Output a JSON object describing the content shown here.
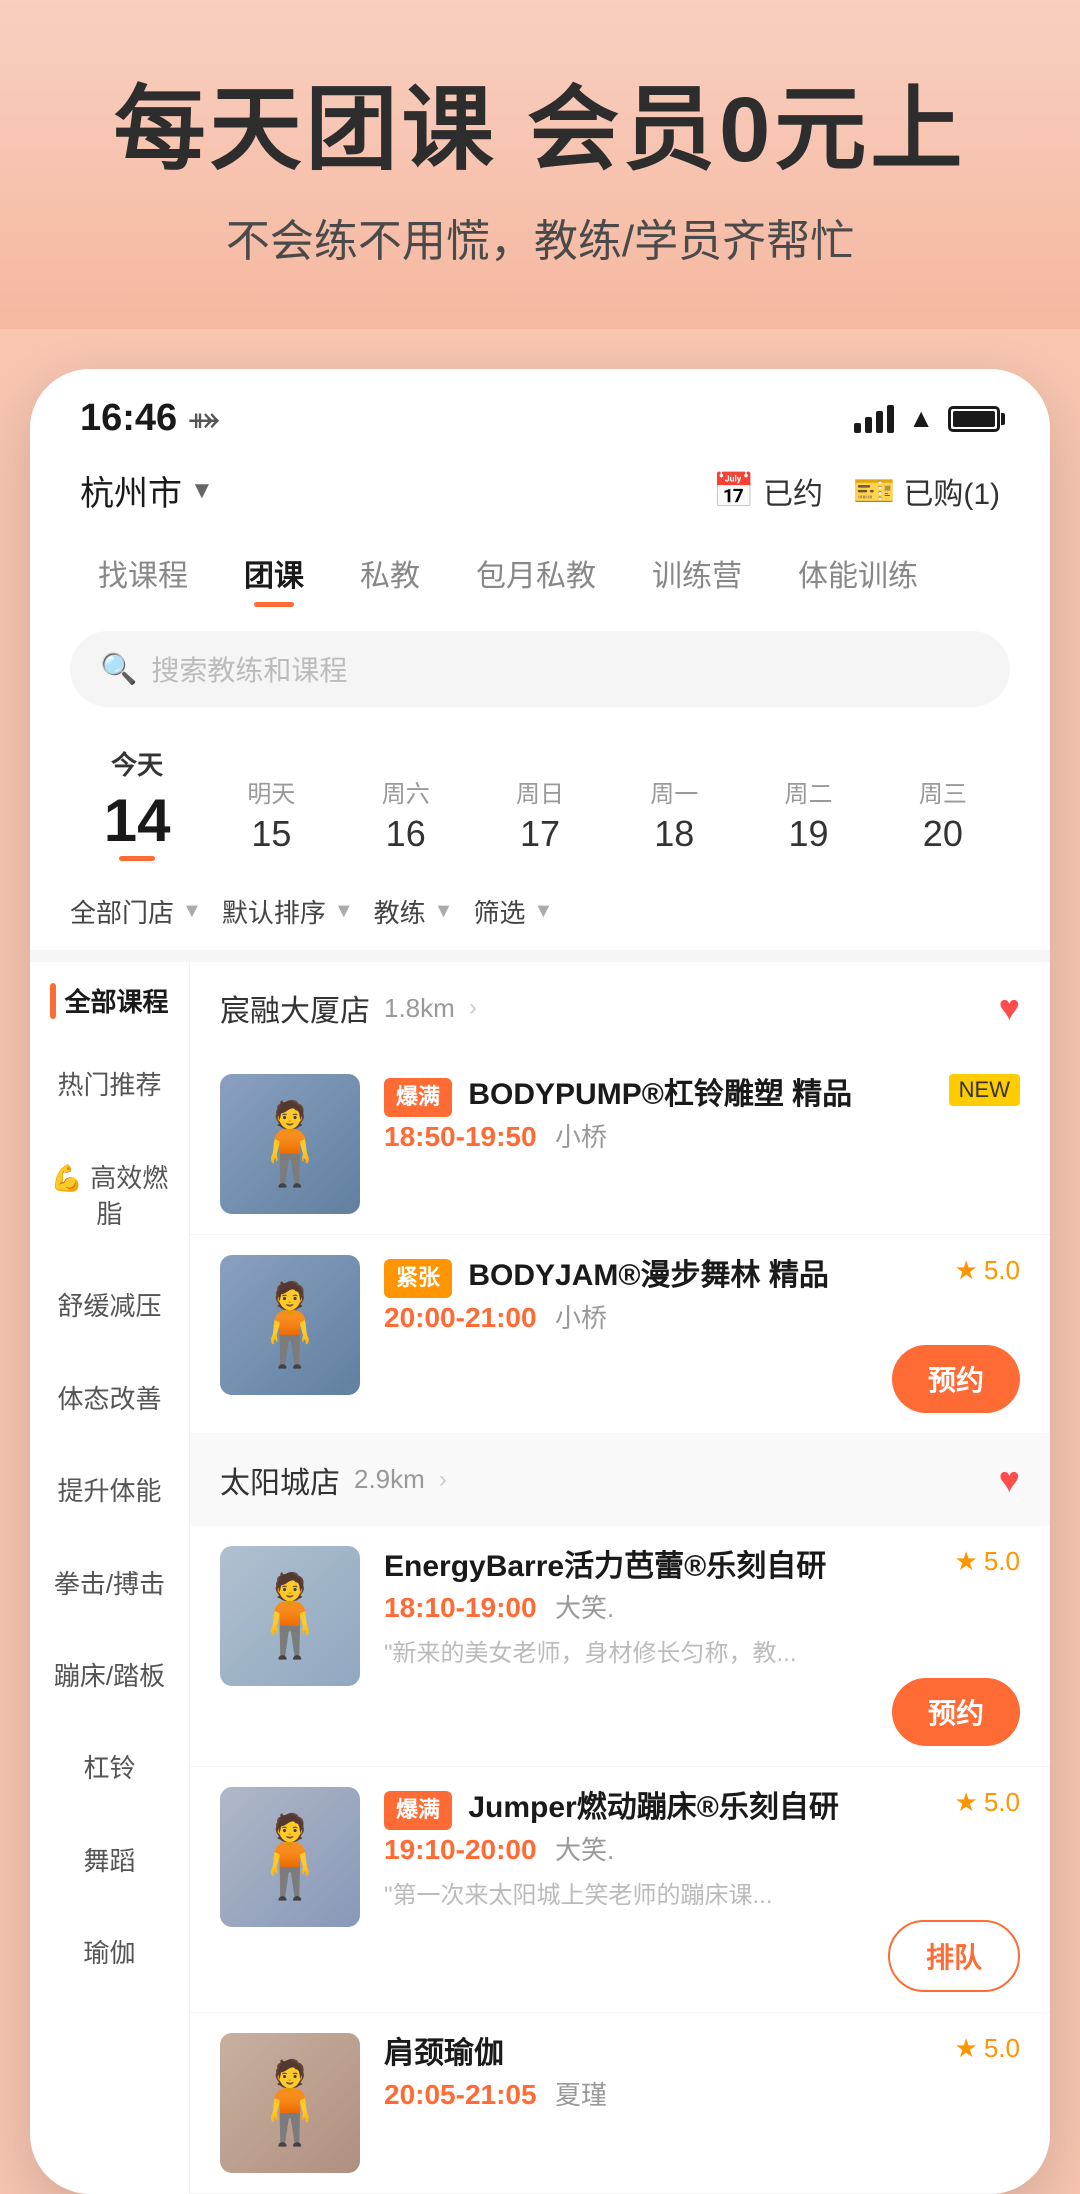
{
  "hero": {
    "title": "每天团课 会员0元上",
    "subtitle": "不会练不用慌，教练/学员齐帮忙"
  },
  "statusBar": {
    "time": "16:46",
    "navIcon": "⤀"
  },
  "header": {
    "location": "杭州市",
    "btn1": "已约",
    "btn2": "已购(1)"
  },
  "navTabs": [
    {
      "label": "找课程",
      "active": false
    },
    {
      "label": "团课",
      "active": true
    },
    {
      "label": "私教",
      "active": false
    },
    {
      "label": "包月私教",
      "active": false
    },
    {
      "label": "训练营",
      "active": false
    },
    {
      "label": "体能训练",
      "active": false
    }
  ],
  "search": {
    "placeholder": "搜索教练和课程"
  },
  "dates": [
    {
      "label": "今天",
      "number": "14",
      "today": true
    },
    {
      "label": "明天",
      "number": "15",
      "today": false
    },
    {
      "label": "周六",
      "number": "16",
      "today": false
    },
    {
      "label": "周日",
      "number": "17",
      "today": false
    },
    {
      "label": "周一",
      "number": "18",
      "today": false
    },
    {
      "label": "周二",
      "number": "19",
      "today": false
    },
    {
      "label": "周三",
      "number": "20",
      "today": false
    }
  ],
  "filters": [
    {
      "label": "全部门店"
    },
    {
      "label": "默认排序"
    },
    {
      "label": "教练"
    },
    {
      "label": "筛选"
    }
  ],
  "sidebar": {
    "sectionTitle": "全部课程",
    "items": [
      {
        "label": "热门推荐",
        "active": false
      },
      {
        "label": "💪 高效燃脂",
        "active": false
      },
      {
        "label": "舒缓减压",
        "active": false
      },
      {
        "label": "体态改善",
        "active": false
      },
      {
        "label": "提升体能",
        "active": false
      },
      {
        "label": "拳击/搏击",
        "active": false
      },
      {
        "label": "蹦床/踏板",
        "active": false
      },
      {
        "label": "杠铃",
        "active": false
      },
      {
        "label": "舞蹈",
        "active": false
      },
      {
        "label": "瑜伽",
        "active": false
      }
    ]
  },
  "stores": [
    {
      "name": "宸融大厦店",
      "distance": "1.8km",
      "favorited": true,
      "courses": [
        {
          "badge": "爆满",
          "badgeType": "full",
          "tagNew": true,
          "title": "BODYPUMP®杠铃雕塑 精品",
          "time": "18:50-19:50",
          "teacher": "小桥",
          "rating": null,
          "desc": "",
          "action": null
        },
        {
          "badge": "紧张",
          "badgeType": "tight",
          "tagNew": false,
          "title": "BODYJAM®漫步舞林 精品",
          "time": "20:00-21:00",
          "teacher": "小桥",
          "rating": "5.0",
          "desc": "",
          "action": "预约"
        }
      ]
    },
    {
      "name": "太阳城店",
      "distance": "2.9km",
      "favorited": true,
      "courses": [
        {
          "badge": null,
          "badgeType": null,
          "tagNew": false,
          "title": "EnergyBarre活力芭蕾®乐刻自研",
          "time": "18:10-19:00",
          "teacher": "大笑.",
          "rating": "5.0",
          "desc": "\"新来的美女老师，身材修长匀称，教...",
          "action": "预约"
        },
        {
          "badge": "爆满",
          "badgeType": "full",
          "tagNew": false,
          "title": "Jumper燃动蹦床®乐刻自研",
          "time": "19:10-20:00",
          "teacher": "大笑.",
          "rating": "5.0",
          "desc": "\"第一次来太阳城上笑老师的蹦床课...",
          "action": "排队"
        },
        {
          "badge": null,
          "badgeType": null,
          "tagNew": false,
          "title": "肩颈瑜伽",
          "time": "20:05-21:05",
          "teacher": "夏瑾",
          "rating": "5.0",
          "desc": "",
          "action": null
        }
      ]
    }
  ]
}
